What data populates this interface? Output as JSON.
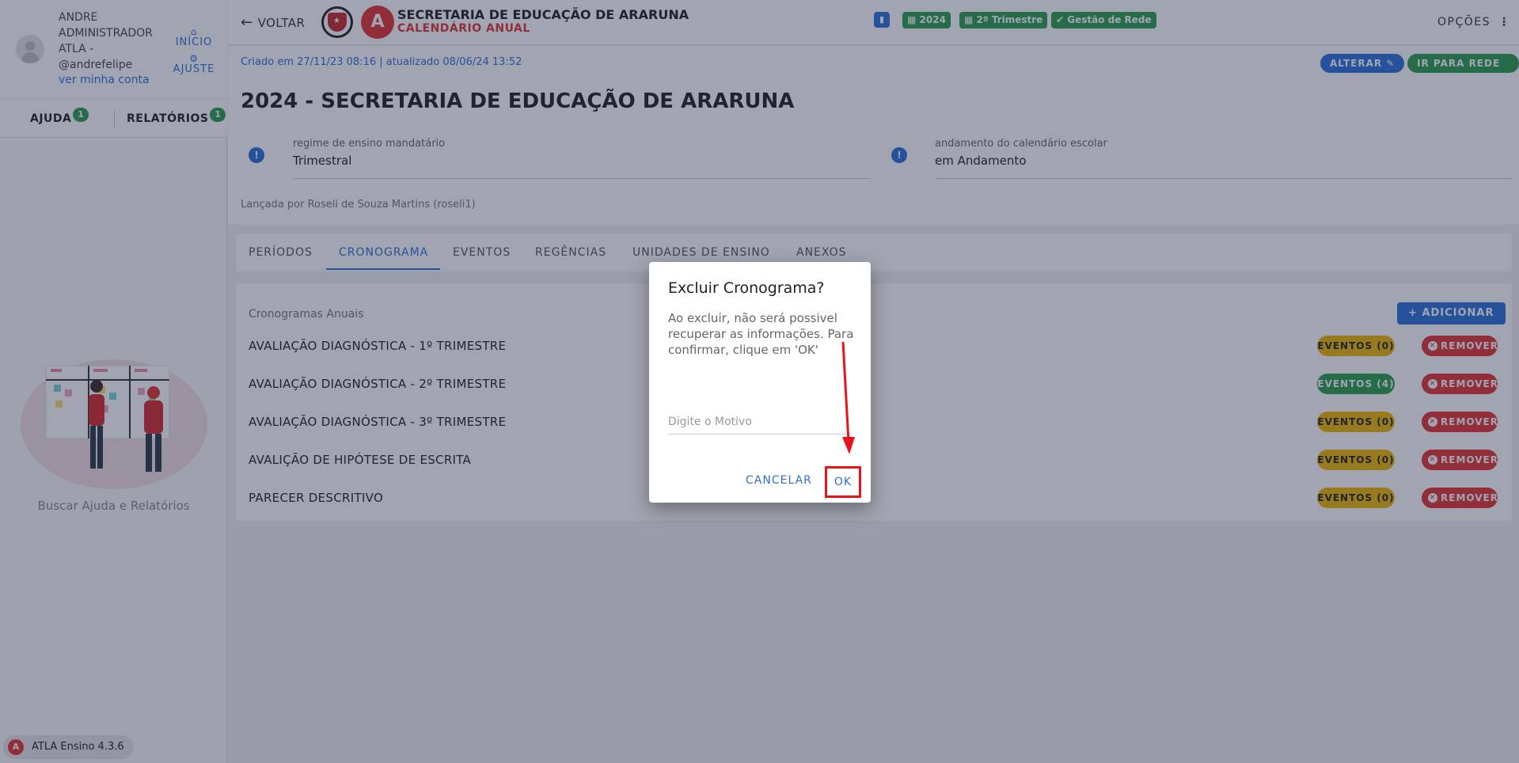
{
  "user": {
    "name": "ANDRE ADMINISTRADOR ATLA - @andrefelipe",
    "account_link": "ver minha conta",
    "inicio_label": "INÍCIO",
    "ajuste_label": "AJUSTE"
  },
  "sidebar": {
    "tabs": [
      {
        "label": "AJUDA",
        "badge": "1"
      },
      {
        "label": "RELATÓRIOS",
        "badge": "1"
      }
    ],
    "help_caption": "Buscar Ajuda e Relatórios",
    "version": "ATLA Ensino 4.3.6"
  },
  "header": {
    "back_label": "VOLTAR",
    "org_title": "SECRETARIA DE EDUCAÇÃO DE ARARUNA",
    "org_subtitle": "CALENDÁRIO ANUAL",
    "chips": [
      {
        "label": "2024"
      },
      {
        "label": "2º Trimestre"
      },
      {
        "label": "Gestão de Rede"
      }
    ],
    "options_label": "OPÇÕES"
  },
  "info": {
    "created": "Criado em 27/11/23 08:16 | atualizado 08/06/24 13:52",
    "alterar_label": "ALTERAR",
    "ir_rede_label": "IR PARA REDE",
    "title": "2024 - SECRETARIA DE EDUCAÇÃO DE ARARUNA",
    "fields": [
      {
        "label": "regime de ensino mandatário",
        "value": "Trimestral"
      },
      {
        "label": "andamento do calendário escolar",
        "value": "em Andamento"
      }
    ],
    "launched_by": "Lançada por Roseli de Souza Martins (roseli1)"
  },
  "tabs": [
    {
      "label": "PERÍODOS"
    },
    {
      "label": "CRONOGRAMA"
    },
    {
      "label": "EVENTOS"
    },
    {
      "label": "REGÊNCIAS"
    },
    {
      "label": "UNIDADES DE ENSINO"
    },
    {
      "label": "ANEXOS"
    }
  ],
  "list": {
    "title": "Cronogramas Anuais",
    "add_label": "ADICIONAR",
    "remove_label": "REMOVER",
    "rows": [
      {
        "label": "AVALIAÇÃO DIAGNÓSTICA - 1º TRIMESTRE",
        "events": "EVENTOS (0)"
      },
      {
        "label": "AVALIAÇÃO DIAGNÓSTICA - 2º TRIMESTRE",
        "events": "EVENTOS (4)"
      },
      {
        "label": "AVALIAÇÃO DIAGNÓSTICA - 3º TRIMESTRE",
        "events": "EVENTOS (0)"
      },
      {
        "label": "AVALIÇÃO DE HIPÓTESE DE ESCRITA",
        "events": "EVENTOS (0)"
      },
      {
        "label": "PARECER DESCRITIVO",
        "events": "EVENTOS (0)"
      }
    ]
  },
  "dialog": {
    "title": "Excluir Cronograma?",
    "text": "Ao excluir, não será possivel recuperar as informações. Para confirmar, clique em 'OK'",
    "input_placeholder": "Digite o Motivo",
    "input_value": "",
    "cancel_label": "CANCELAR",
    "ok_label": "OK"
  },
  "colors": {
    "primary": "#2b6fd9",
    "success": "#2e9e4a",
    "warning": "#f2b705",
    "danger": "#e63232",
    "highlight": "#e8141a"
  }
}
